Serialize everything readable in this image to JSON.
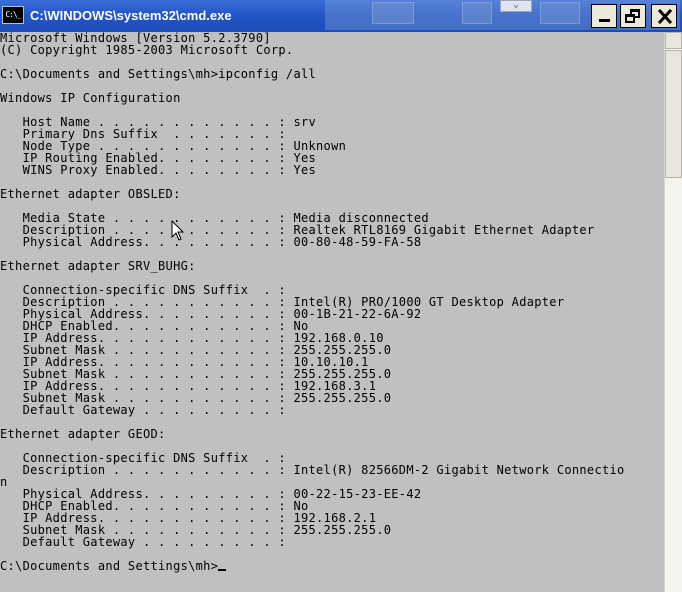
{
  "window": {
    "title": "C:\\WINDOWS\\system32\\cmd.exe",
    "icon": "cmd-icon",
    "icon_text": "C:\\_"
  },
  "controls": {
    "minimize": "minimize-icon",
    "maximize": "restore-icon",
    "close": "close-icon"
  },
  "console": {
    "lines": [
      "Microsoft Windows [Version 5.2.3790]",
      "(C) Copyright 1985-2003 Microsoft Corp.",
      "",
      "C:\\Documents and Settings\\mh>ipconfig /all",
      "",
      "Windows IP Configuration",
      "",
      "   Host Name . . . . . . . . . . . . : srv",
      "   Primary Dns Suffix  . . . . . . . :",
      "   Node Type . . . . . . . . . . . . : Unknown",
      "   IP Routing Enabled. . . . . . . . : Yes",
      "   WINS Proxy Enabled. . . . . . . . : Yes",
      "",
      "Ethernet adapter OBSLED:",
      "",
      "   Media State . . . . . . . . . . . : Media disconnected",
      "   Description . . . . . . . . . . . : Realtek RTL8169 Gigabit Ethernet Adapter",
      "   Physical Address. . . . . . . . . : 00-80-48-59-FA-58",
      "",
      "Ethernet adapter SRV_BUHG:",
      "",
      "   Connection-specific DNS Suffix  . :",
      "   Description . . . . . . . . . . . : Intel(R) PRO/1000 GT Desktop Adapter",
      "   Physical Address. . . . . . . . . : 00-1B-21-22-6A-92",
      "   DHCP Enabled. . . . . . . . . . . : No",
      "   IP Address. . . . . . . . . . . . : 192.168.0.10",
      "   Subnet Mask . . . . . . . . . . . : 255.255.255.0",
      "   IP Address. . . . . . . . . . . . : 10.10.10.1",
      "   Subnet Mask . . . . . . . . . . . : 255.255.255.0",
      "   IP Address. . . . . . . . . . . . : 192.168.3.1",
      "   Subnet Mask . . . . . . . . . . . : 255.255.255.0",
      "   Default Gateway . . . . . . . . . :",
      "",
      "Ethernet adapter GEOD:",
      "",
      "   Connection-specific DNS Suffix  . :",
      "   Description . . . . . . . . . . . : Intel(R) 82566DM-2 Gigabit Network Connectio",
      "n",
      "   Physical Address. . . . . . . . . : 00-22-15-23-EE-42",
      "   DHCP Enabled. . . . . . . . . . . : No",
      "   IP Address. . . . . . . . . . . . : 192.168.2.1",
      "   Subnet Mask . . . . . . . . . . . : 255.255.255.0",
      "   Default Gateway . . . . . . . . . :",
      ""
    ],
    "prompt": "C:\\Documents and Settings\\mh>"
  },
  "colors": {
    "console_bg": "#c0c0c0",
    "console_text": "#000000",
    "titlebar": "#2456c8"
  }
}
